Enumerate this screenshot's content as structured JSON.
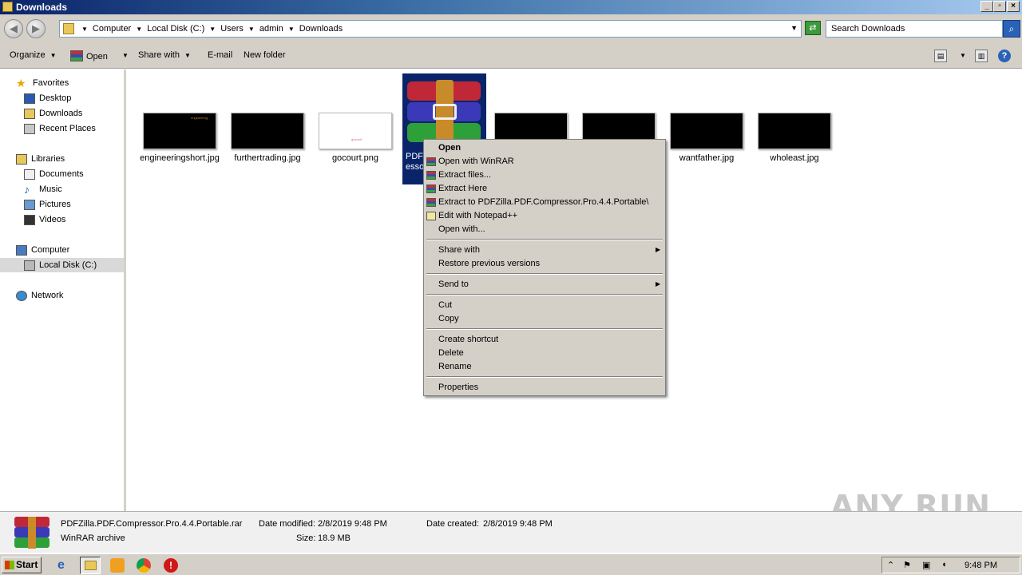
{
  "window": {
    "title": "Downloads"
  },
  "address": {
    "crumbs": [
      "Computer",
      "Local Disk (C:)",
      "Users",
      "admin",
      "Downloads"
    ],
    "search_placeholder": "Search Downloads"
  },
  "toolbar": {
    "organize": "Organize",
    "open": "Open",
    "share_with": "Share with",
    "email": "E-mail",
    "new_folder": "New folder"
  },
  "nav": {
    "favorites": "Favorites",
    "desktop": "Desktop",
    "downloads": "Downloads",
    "recent_places": "Recent Places",
    "libraries": "Libraries",
    "documents": "Documents",
    "music": "Music",
    "pictures": "Pictures",
    "videos": "Videos",
    "computer": "Computer",
    "local_disk": "Local Disk (C:)",
    "network": "Network"
  },
  "files": {
    "f1": {
      "name": "engineeringshort.jpg",
      "thumb_text": "engineering"
    },
    "f2": {
      "name": "furthertrading.jpg"
    },
    "f3": {
      "name": "gocourt.png",
      "thumb_text": "gocourt"
    },
    "selected_partial": "PDFZ\nesso",
    "f7": {
      "name": "wantfather.jpg"
    },
    "f8": {
      "name": "wholeast.jpg"
    }
  },
  "context_menu": {
    "open": "Open",
    "open_with_winrar": "Open with WinRAR",
    "extract_files": "Extract files...",
    "extract_here": "Extract Here",
    "extract_to": "Extract to PDFZilla.PDF.Compressor.Pro.4.4.Portable\\",
    "edit_notepad": "Edit with Notepad++",
    "open_with": "Open with...",
    "share_with": "Share with",
    "restore_versions": "Restore previous versions",
    "send_to": "Send to",
    "cut": "Cut",
    "copy": "Copy",
    "create_shortcut": "Create shortcut",
    "delete": "Delete",
    "rename": "Rename",
    "properties": "Properties"
  },
  "details": {
    "filename": "PDFZilla.PDF.Compressor.Pro.4.4.Portable.rar",
    "type": "WinRAR archive",
    "modified_label": "Date modified:",
    "modified_value": "2/8/2019 9:48 PM",
    "size_label": "Size:",
    "size_value": "18.9 MB",
    "created_label": "Date created:",
    "created_value": "2/8/2019 9:48 PM"
  },
  "watermark": "ANY RUN",
  "taskbar": {
    "start": "Start",
    "clock": "9:48 PM"
  }
}
